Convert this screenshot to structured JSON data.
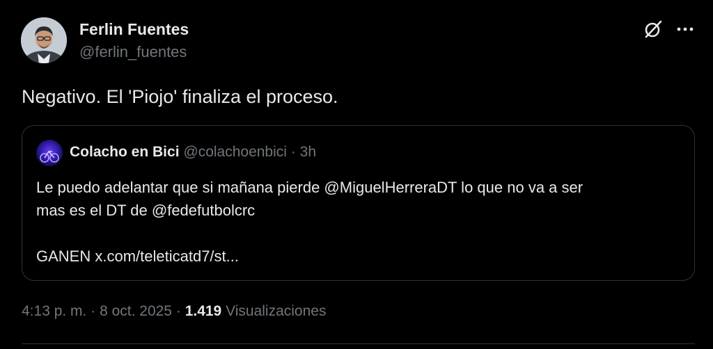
{
  "author": {
    "name": "Ferlin Fuentes",
    "handle": "@ferlin_fuentes"
  },
  "tweet": {
    "text": "Negativo. El 'Piojo' finaliza el proceso."
  },
  "quoted": {
    "name": "Colacho en Bici",
    "handle": "@colachoenbici",
    "separator": "·",
    "time": "3h",
    "line1": "Le puedo adelantar que si mañana pierde @MiguelHerreraDT lo que no va a ser",
    "line2": "mas es el DT de @fedefutbolcrc",
    "line3": "GANEN x.com/teleticatd7/st..."
  },
  "meta": {
    "time": "4:13 p. m.",
    "sep1": "·",
    "date": "8 oct. 2025",
    "sep2": "·",
    "views_count": "1.419",
    "views_label": "Visualizaciones"
  },
  "icons": {
    "grok": "grok-icon",
    "more": "more-icon"
  },
  "colors": {
    "background": "#000000",
    "primary_text": "#e7e9ea",
    "secondary_text": "#71767b",
    "border": "#2f3336"
  }
}
